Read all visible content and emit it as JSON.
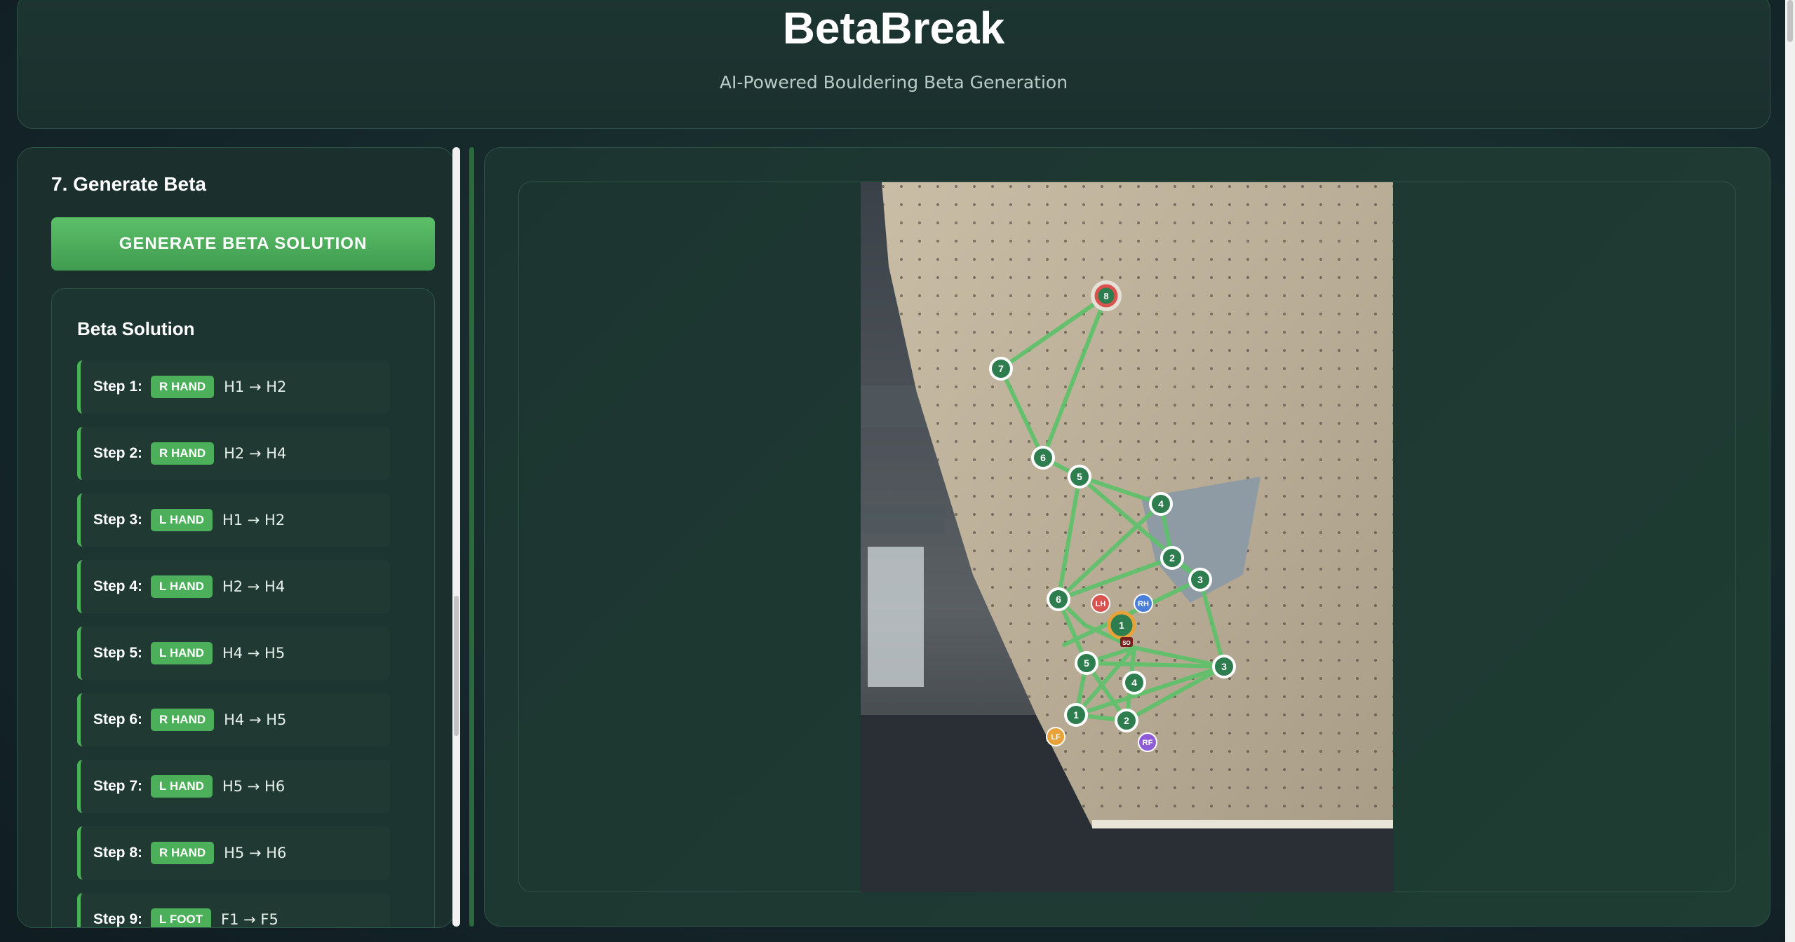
{
  "app": {
    "title": "BetaBreak",
    "subtitle": "AI-Powered Bouldering Beta Generation"
  },
  "sidebar": {
    "section_title": "7. Generate Beta",
    "generate_button": "GENERATE BETA SOLUTION",
    "beta_title": "Beta Solution",
    "steps": [
      {
        "label": "Step 1:",
        "limb": "R HAND",
        "move": "H1 → H2"
      },
      {
        "label": "Step 2:",
        "limb": "R HAND",
        "move": "H2 → H4"
      },
      {
        "label": "Step 3:",
        "limb": "L HAND",
        "move": "H1 → H2"
      },
      {
        "label": "Step 4:",
        "limb": "L HAND",
        "move": "H2 → H4"
      },
      {
        "label": "Step 5:",
        "limb": "L HAND",
        "move": "H4 → H5"
      },
      {
        "label": "Step 6:",
        "limb": "R HAND",
        "move": "H4 → H5"
      },
      {
        "label": "Step 7:",
        "limb": "L HAND",
        "move": "H5 → H6"
      },
      {
        "label": "Step 8:",
        "limb": "R HAND",
        "move": "H5 → H6"
      },
      {
        "label": "Step 9:",
        "limb": "L FOOT",
        "move": "F1 → F5"
      }
    ]
  },
  "wall_overlay": {
    "holds": [
      "8",
      "7",
      "6",
      "5",
      "4",
      "2",
      "3",
      "6",
      "1",
      "5",
      "4",
      "3",
      "1",
      "2"
    ],
    "limb_markers": [
      "LH",
      "RH",
      "LF",
      "RF"
    ],
    "start_marker": "SO",
    "colors": {
      "hold_fill": "#2e7d4f",
      "route_line": "#5cc26a",
      "lh": "#d9534f",
      "rh": "#4a7fd9",
      "lf": "#e8a23a",
      "rf": "#8e5cd9"
    }
  },
  "theme": {
    "accent": "#4caf5a",
    "panel_border": "#2e5347"
  }
}
